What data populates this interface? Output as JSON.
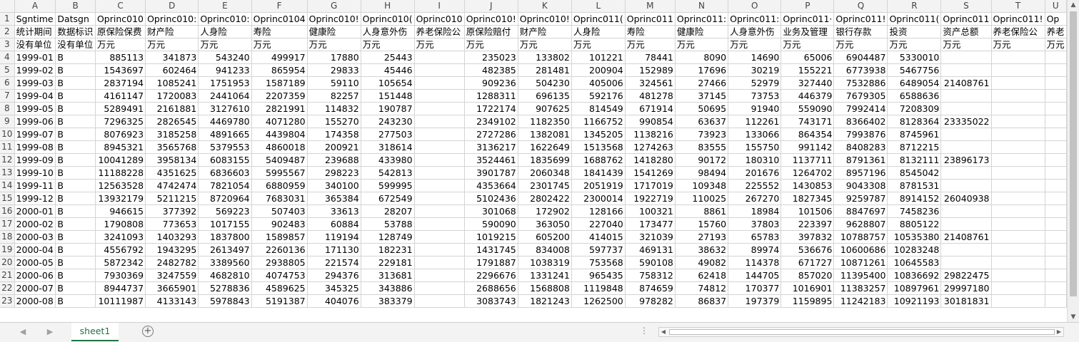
{
  "columns": [
    "A",
    "B",
    "C",
    "D",
    "E",
    "F",
    "G",
    "H",
    "I",
    "J",
    "K",
    "L",
    "M",
    "N",
    "O",
    "P",
    "Q",
    "R",
    "S",
    "T",
    "U"
  ],
  "header_row_labels": [
    "Sgntime",
    "Datsgn",
    "Oprinc010",
    "Oprinc010:",
    "Oprinc010:",
    "Oprinc0104",
    "Oprinc010!",
    "Oprinc010(",
    "Oprinc010",
    "Oprinc010!",
    "Oprinc010!",
    "Oprinc011(",
    "Oprinc011",
    "Oprinc011:",
    "Oprinc011:",
    "Oprinc011·",
    "Oprinc011!",
    "Oprinc011(",
    "Oprinc011",
    "Oprinc011!",
    "Op"
  ],
  "name_row_labels": [
    "统计期间",
    "数据标识",
    "原保险保费",
    "财产险",
    "人身险",
    "寿险",
    "健康险",
    "人身意外伤",
    "养老保险公",
    "原保险赔付",
    "财产险",
    "人身险",
    "寿险",
    "健康险",
    "人身意外伤",
    "业务及管理",
    "银行存款",
    "投资",
    "资产总额",
    "养老保险公",
    "养老"
  ],
  "unit_row_labels": [
    "没有单位",
    "没有单位",
    "万元",
    "万元",
    "万元",
    "万元",
    "万元",
    "万元",
    "万元",
    "万元",
    "万元",
    "万元",
    "万元",
    "万元",
    "万元",
    "万元",
    "万元",
    "万元",
    "万元",
    "万元",
    "万元"
  ],
  "rows": [
    {
      "n": "4",
      "d": [
        "1999-01",
        "B",
        "885113",
        "341873",
        "543240",
        "499917",
        "17880",
        "25443",
        "",
        "235023",
        "133802",
        "101221",
        "78441",
        "8090",
        "14690",
        "65006",
        "6904487",
        "5330010",
        "",
        "",
        ""
      ]
    },
    {
      "n": "5",
      "d": [
        "1999-02",
        "B",
        "1543697",
        "602464",
        "941233",
        "865954",
        "29833",
        "45446",
        "",
        "482385",
        "281481",
        "200904",
        "152989",
        "17696",
        "30219",
        "155221",
        "6773938",
        "5467756",
        "",
        "",
        ""
      ]
    },
    {
      "n": "6",
      "d": [
        "1999-03",
        "B",
        "2837194",
        "1085241",
        "1751953",
        "1587189",
        "59110",
        "105654",
        "",
        "909236",
        "504230",
        "405006",
        "324561",
        "27466",
        "52979",
        "327440",
        "7532886",
        "6489054",
        "21408761",
        "",
        ""
      ]
    },
    {
      "n": "7",
      "d": [
        "1999-04",
        "B",
        "4161147",
        "1720083",
        "2441064",
        "2207359",
        "82257",
        "151448",
        "",
        "1288311",
        "696135",
        "592176",
        "481278",
        "37145",
        "73753",
        "446379",
        "7679305",
        "6588636",
        "",
        "",
        ""
      ]
    },
    {
      "n": "8",
      "d": [
        "1999-05",
        "B",
        "5289491",
        "2161881",
        "3127610",
        "2821991",
        "114832",
        "190787",
        "",
        "1722174",
        "907625",
        "814549",
        "671914",
        "50695",
        "91940",
        "559090",
        "7992414",
        "7208309",
        "",
        "",
        ""
      ]
    },
    {
      "n": "9",
      "d": [
        "1999-06",
        "B",
        "7296325",
        "2826545",
        "4469780",
        "4071280",
        "155270",
        "243230",
        "",
        "2349102",
        "1182350",
        "1166752",
        "990854",
        "63637",
        "112261",
        "743171",
        "8366402",
        "8128364",
        "23335022",
        "",
        ""
      ]
    },
    {
      "n": "10",
      "d": [
        "1999-07",
        "B",
        "8076923",
        "3185258",
        "4891665",
        "4439804",
        "174358",
        "277503",
        "",
        "2727286",
        "1382081",
        "1345205",
        "1138216",
        "73923",
        "133066",
        "864354",
        "7993876",
        "8745961",
        "",
        "",
        ""
      ]
    },
    {
      "n": "11",
      "d": [
        "1999-08",
        "B",
        "8945321",
        "3565768",
        "5379553",
        "4860018",
        "200921",
        "318614",
        "",
        "3136217",
        "1622649",
        "1513568",
        "1274263",
        "83555",
        "155750",
        "991142",
        "8408283",
        "8712215",
        "",
        "",
        ""
      ]
    },
    {
      "n": "12",
      "d": [
        "1999-09",
        "B",
        "10041289",
        "3958134",
        "6083155",
        "5409487",
        "239688",
        "433980",
        "",
        "3524461",
        "1835699",
        "1688762",
        "1418280",
        "90172",
        "180310",
        "1137711",
        "8791361",
        "8132111",
        "23896173",
        "",
        ""
      ]
    },
    {
      "n": "13",
      "d": [
        "1999-10",
        "B",
        "11188228",
        "4351625",
        "6836603",
        "5995567",
        "298223",
        "542813",
        "",
        "3901787",
        "2060348",
        "1841439",
        "1541269",
        "98494",
        "201676",
        "1264702",
        "8957196",
        "8545042",
        "",
        "",
        ""
      ]
    },
    {
      "n": "14",
      "d": [
        "1999-11",
        "B",
        "12563528",
        "4742474",
        "7821054",
        "6880959",
        "340100",
        "599995",
        "",
        "4353664",
        "2301745",
        "2051919",
        "1717019",
        "109348",
        "225552",
        "1430853",
        "9043308",
        "8781531",
        "",
        "",
        ""
      ]
    },
    {
      "n": "15",
      "d": [
        "1999-12",
        "B",
        "13932179",
        "5211215",
        "8720964",
        "7683031",
        "365384",
        "672549",
        "",
        "5102436",
        "2802422",
        "2300014",
        "1922719",
        "110025",
        "267270",
        "1827345",
        "9259787",
        "8914152",
        "26040938",
        "",
        ""
      ]
    },
    {
      "n": "16",
      "d": [
        "2000-01",
        "B",
        "946615",
        "377392",
        "569223",
        "507403",
        "33613",
        "28207",
        "",
        "301068",
        "172902",
        "128166",
        "100321",
        "8861",
        "18984",
        "101506",
        "8847697",
        "7458236",
        "",
        "",
        ""
      ]
    },
    {
      "n": "17",
      "d": [
        "2000-02",
        "B",
        "1790808",
        "773653",
        "1017155",
        "902483",
        "60884",
        "53788",
        "",
        "590090",
        "363050",
        "227040",
        "173477",
        "15760",
        "37803",
        "223397",
        "9628807",
        "8805122",
        "",
        "",
        ""
      ]
    },
    {
      "n": "18",
      "d": [
        "2000-03",
        "B",
        "3241093",
        "1403293",
        "1837800",
        "1589857",
        "119194",
        "128749",
        "",
        "1019215",
        "605200",
        "414015",
        "321039",
        "27193",
        "65783",
        "397832",
        "10788757",
        "10535380",
        "21408761",
        "",
        ""
      ]
    },
    {
      "n": "19",
      "d": [
        "2000-04",
        "B",
        "4556792",
        "1943295",
        "2613497",
        "2260136",
        "171130",
        "182231",
        "",
        "1431745",
        "834008",
        "597737",
        "469131",
        "38632",
        "89974",
        "536676",
        "10600686",
        "10283248",
        "",
        "",
        ""
      ]
    },
    {
      "n": "20",
      "d": [
        "2000-05",
        "B",
        "5872342",
        "2482782",
        "3389560",
        "2938805",
        "221574",
        "229181",
        "",
        "1791887",
        "1038319",
        "753568",
        "590108",
        "49082",
        "114378",
        "671727",
        "10871261",
        "10645583",
        "",
        "",
        ""
      ]
    },
    {
      "n": "21",
      "d": [
        "2000-06",
        "B",
        "7930369",
        "3247559",
        "4682810",
        "4074753",
        "294376",
        "313681",
        "",
        "2296676",
        "1331241",
        "965435",
        "758312",
        "62418",
        "144705",
        "857020",
        "11395400",
        "10836692",
        "29822475",
        "",
        ""
      ]
    },
    {
      "n": "22",
      "d": [
        "2000-07",
        "B",
        "8944737",
        "3665901",
        "5278836",
        "4589625",
        "345325",
        "343886",
        "",
        "2688656",
        "1568808",
        "1119848",
        "874659",
        "74812",
        "170377",
        "1016901",
        "11383257",
        "10897961",
        "29997180",
        "",
        ""
      ]
    },
    {
      "n": "23",
      "d": [
        "2000-08",
        "B",
        "10111987",
        "4133143",
        "5978843",
        "5191387",
        "404076",
        "383379",
        "",
        "3083743",
        "1821243",
        "1262500",
        "978282",
        "86837",
        "197379",
        "1159895",
        "11242183",
        "10921193",
        "30181831",
        "",
        ""
      ]
    }
  ],
  "sheet_tab_label": "sheet1",
  "add_sheet_symbol": "+",
  "dots": "⋮",
  "icons": {
    "scroll_up": "▲",
    "scroll_down": "▼",
    "scroll_left": "◀",
    "scroll_right": "▶",
    "nav_prev": "◀",
    "nav_next": "▶"
  },
  "colors": {
    "accent": "#217346",
    "grid": "#d4d4d4",
    "header_bg": "#f3f3f3"
  }
}
